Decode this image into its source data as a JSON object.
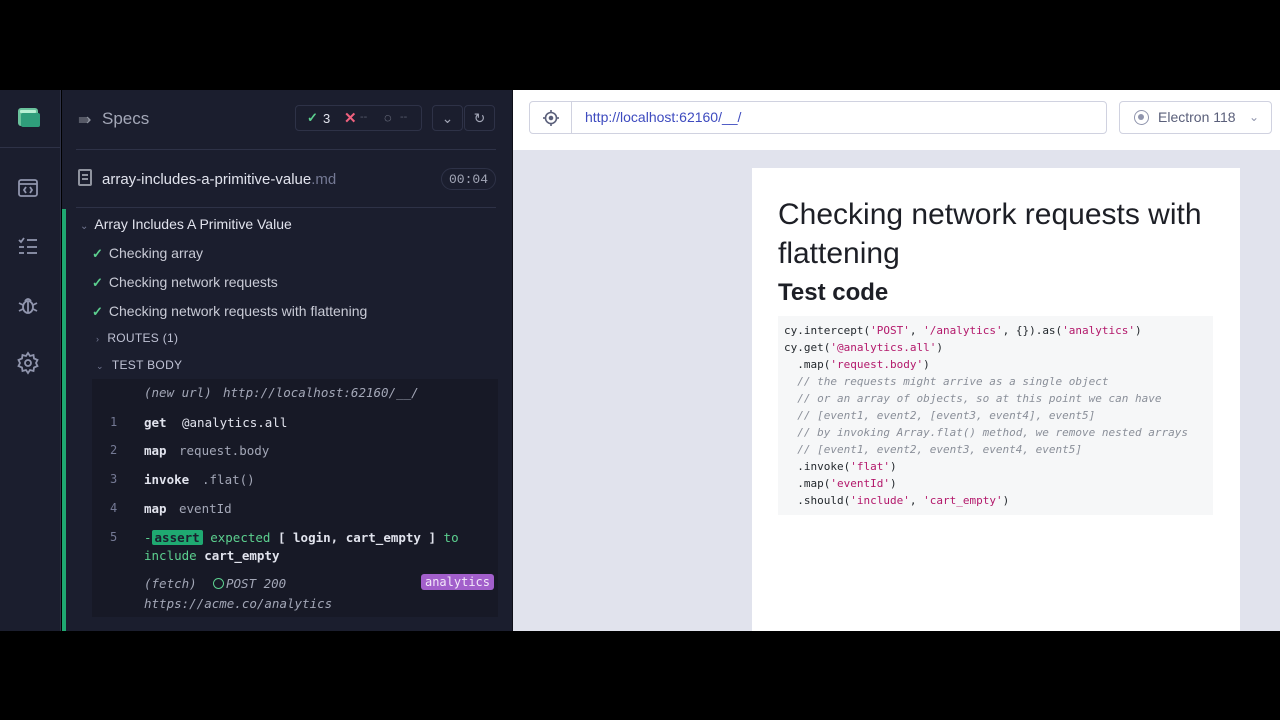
{
  "reporter": {
    "header": {
      "specs_label": "Specs",
      "passed_count": "3",
      "failed_count": "--",
      "pending_count": "--"
    },
    "file": {
      "name": "array-includes-a-primitive-value",
      "ext": ".md",
      "duration": "00:04"
    },
    "suite_title": "Array Includes A Primitive Value",
    "tests": [
      {
        "title": "Checking array"
      },
      {
        "title": "Checking network requests"
      },
      {
        "title": "Checking network requests with flattening"
      }
    ],
    "routes_label": "ROUTES (1)",
    "test_body_label": "TEST BODY",
    "new_url": {
      "label": "(new url)",
      "url": "http://localhost:62160/__/"
    },
    "commands": [
      {
        "num": "1",
        "name": "get",
        "message": "@analytics.all"
      },
      {
        "num": "2",
        "name": "map",
        "message": "request.body"
      },
      {
        "num": "3",
        "name": "invoke",
        "message": ".flat()"
      },
      {
        "num": "4",
        "name": "map",
        "message": "eventId"
      }
    ],
    "assertion": {
      "num": "5",
      "prefix": "-",
      "tag": "assert",
      "expected": "expected",
      "value": "[ login, cart_empty ]",
      "to": "to",
      "include": "include",
      "target": "cart_empty"
    },
    "fetch": {
      "label": "(fetch)",
      "method_status": "POST 200",
      "url": "https://acme.co/analytics",
      "alias": "analytics"
    }
  },
  "aut": {
    "url": "http://localhost:62160/__/",
    "browser": "Electron 118",
    "page_title": "Checking network requests with flattening",
    "section_heading": "Test code",
    "code_lines": [
      [
        {
          "t": "cy.intercept("
        },
        {
          "t": "'POST'",
          "k": "s"
        },
        {
          "t": ", "
        },
        {
          "t": "'/analytics'",
          "k": "s"
        },
        {
          "t": ", {}).as("
        },
        {
          "t": "'analytics'",
          "k": "s"
        },
        {
          "t": ")"
        }
      ],
      [
        {
          "t": "cy.get("
        },
        {
          "t": "'@analytics.all'",
          "k": "s"
        },
        {
          "t": ")"
        }
      ],
      [
        {
          "t": "  .map("
        },
        {
          "t": "'request.body'",
          "k": "s"
        },
        {
          "t": ")"
        }
      ],
      [
        {
          "t": "  "
        },
        {
          "t": "// the requests might arrive as a single object",
          "k": "c"
        }
      ],
      [
        {
          "t": "  "
        },
        {
          "t": "// or an array of objects, so at this point we can have",
          "k": "c"
        }
      ],
      [
        {
          "t": "  "
        },
        {
          "t": "// [event1, event2, [event3, event4], event5]",
          "k": "c"
        }
      ],
      [
        {
          "t": "  "
        },
        {
          "t": "// by invoking Array.flat() method, we remove nested arrays",
          "k": "c"
        }
      ],
      [
        {
          "t": "  "
        },
        {
          "t": "// [event1, event2, event3, event4, event5]",
          "k": "c"
        }
      ],
      [
        {
          "t": "  .invoke("
        },
        {
          "t": "'flat'",
          "k": "s"
        },
        {
          "t": ")"
        }
      ],
      [
        {
          "t": "  .map("
        },
        {
          "t": "'eventId'",
          "k": "s"
        },
        {
          "t": ")"
        }
      ],
      [
        {
          "t": "  .should("
        },
        {
          "t": "'include'",
          "k": "s"
        },
        {
          "t": ", "
        },
        {
          "t": "'cart_empty'",
          "k": "s"
        },
        {
          "t": ")"
        }
      ]
    ]
  },
  "colors": {
    "panel_bg": "#1b1e2e",
    "pass_green": "#5cd08f",
    "fail_red": "#f0617e",
    "alias_purple": "#a25fcb",
    "url_blue": "#3e4bbf"
  }
}
